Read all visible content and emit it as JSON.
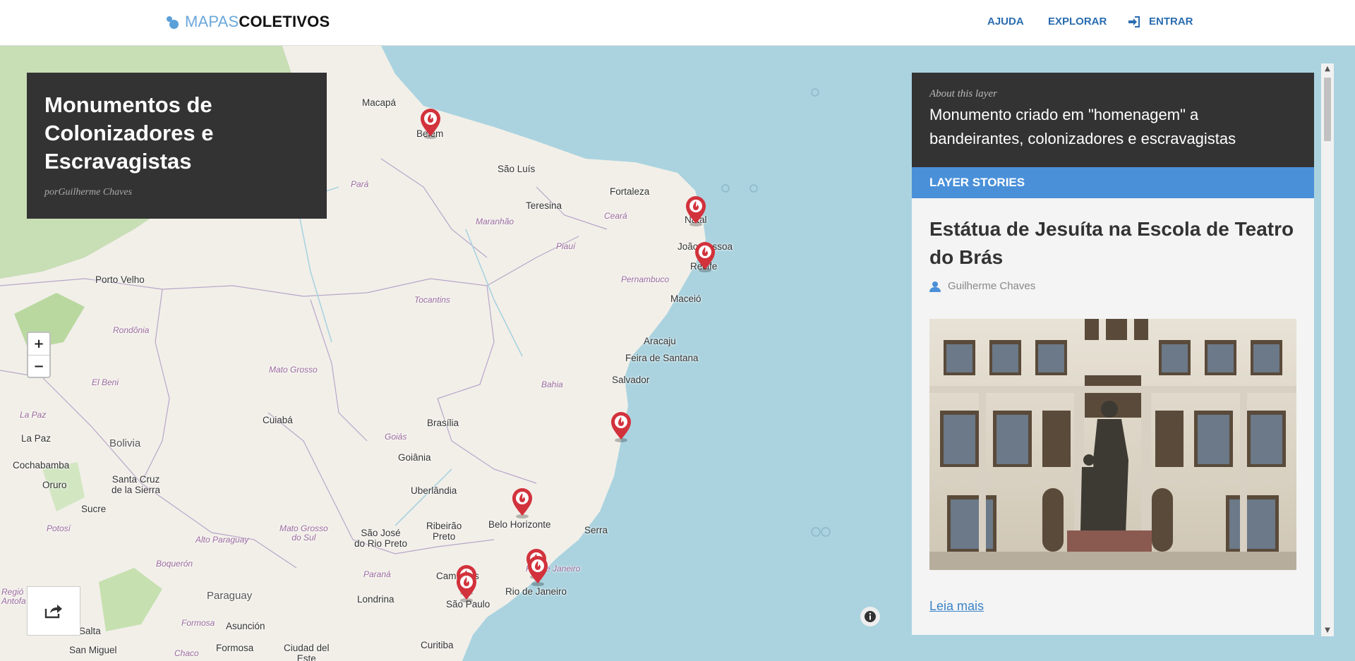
{
  "header": {
    "logo_light": "MAPAS",
    "logo_bold": "COLETIVOS",
    "nav": [
      {
        "label": "AJUDA"
      },
      {
        "label": "EXPLORAR"
      },
      {
        "label": "ENTRAR",
        "icon": "sign-in-icon"
      }
    ]
  },
  "layer": {
    "title": "Monumentos de Colonizadores e Escravagistas",
    "author": "porGuilherme Chaves"
  },
  "map": {
    "zoom_in": "+",
    "zoom_out": "−",
    "labels": {
      "macapa": "Macapá",
      "belem": "Belém",
      "sao_luis": "São Luís",
      "fortaleza": "Fortaleza",
      "teresina": "Teresina",
      "natal": "Natal",
      "joao_pessoa": "João Pessoa",
      "recife": "Recife",
      "maceio": "Maceió",
      "aracaju": "Aracaju",
      "feira": "Feira de Santana",
      "salvador": "Salvador",
      "porto_velho": "Porto Velho",
      "cuiaba": "Cuiabá",
      "brasilia": "Brasília",
      "goiania": "Goiânia",
      "uberlandia": "Uberlândia",
      "bh": "Belo Horizonte",
      "ribeirao": "Ribeirão\nPreto",
      "sjrp": "São José\ndo Rio Preto",
      "serra": "Serra",
      "campinas": "Campinas",
      "sao_paulo": "São Paulo",
      "rio": "Rio de Janeiro",
      "londrina": "Londrina",
      "curitiba": "Curitiba",
      "la_paz": "La Paz",
      "bolivia": "Bolivia",
      "cochabamba": "Cochabamba",
      "oruro": "Oruro",
      "santa_cruz": "Santa Cruz\nde la Sierra",
      "sucre": "Sucre",
      "paraguay": "Paraguay",
      "asuncion": "Asunción",
      "salta": "Salta",
      "san_miguel": "San Miguel",
      "formosa": "Formosa",
      "ciudad_del_este": "Ciudad del\nEste",
      "st_para": "Pará",
      "st_maranhao": "Maranhão",
      "st_ceara": "Ceará",
      "st_piaui": "Piauí",
      "st_pernambuco": "Pernambuco",
      "st_tocantins": "Tocantins",
      "st_rondonia": "Rondônia",
      "st_mato_grosso": "Mato Grosso",
      "st_bahia": "Bahia",
      "st_goias": "Goiás",
      "st_el_beni": "El Beni",
      "st_la_paz": "La Paz",
      "st_potosi": "Potosí",
      "st_ms": "Mato Grosso\ndo Sul",
      "st_alto_paraguay": "Alto Paraguay",
      "st_boqueron": "Boquerón",
      "st_parana": "Paraná",
      "st_formosa": "Formosa",
      "st_chaco": "Chaco",
      "st_rio": "Rio de Janeiro",
      "st_regio": "Regió\nAntofa"
    }
  },
  "panel": {
    "kicker": "About this layer",
    "description": "Monumento criado em \"homenagem\" a bandeirantes, colonizadores e escravagistas",
    "section_label": "LAYER STORIES",
    "story": {
      "title": "Estátua de Jesuíta na Escola de Teatro do Brás",
      "author": "Guilherme Chaves",
      "read_more": "Leia mais"
    }
  },
  "colors": {
    "accent": "#4a90d9",
    "dark": "#333333",
    "marker": "#d2323c",
    "water": "#aad3df",
    "land": "#f2efe9"
  }
}
